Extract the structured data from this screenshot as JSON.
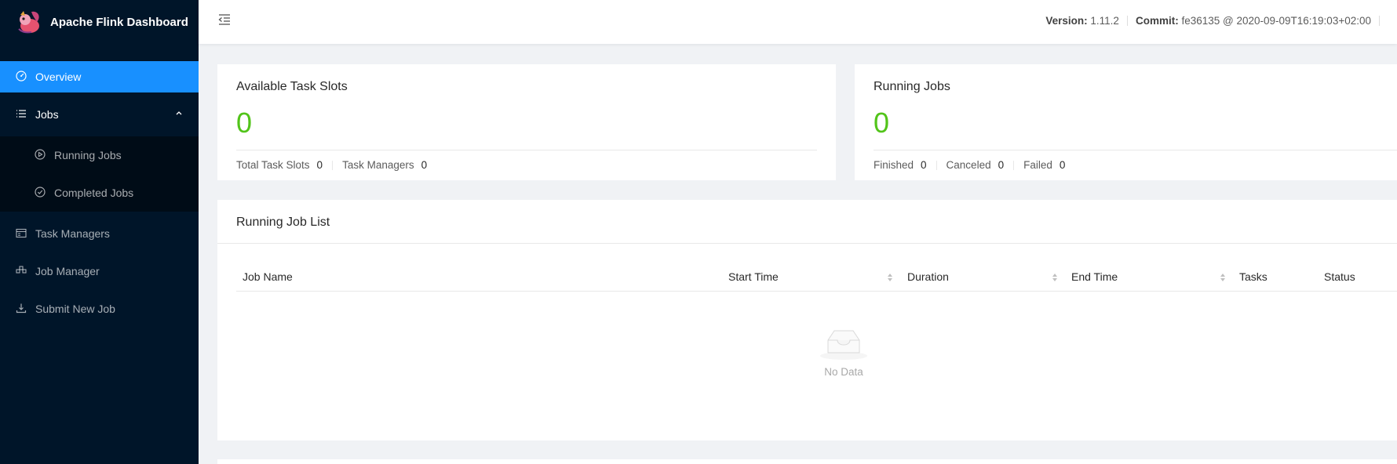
{
  "app": {
    "title": "Apache Flink Dashboard"
  },
  "sidebar": {
    "items": [
      {
        "label": "Overview",
        "icon": "dashboard-icon"
      },
      {
        "label": "Jobs",
        "icon": "list-icon"
      },
      {
        "label": "Running Jobs",
        "icon": "play-circle-icon"
      },
      {
        "label": "Completed Jobs",
        "icon": "check-circle-icon"
      },
      {
        "label": "Task Managers",
        "icon": "schedule-icon"
      },
      {
        "label": "Job Manager",
        "icon": "cluster-icon"
      },
      {
        "label": "Submit New Job",
        "icon": "upload-icon"
      }
    ]
  },
  "header": {
    "version_label": "Version:",
    "version": "1.11.2",
    "commit_label": "Commit:",
    "commit": "fe36135 @ 2020-09-09T16:19:03+02:00"
  },
  "cards": {
    "slots": {
      "title": "Available Task Slots",
      "value": "0",
      "total_label": "Total Task Slots",
      "total_value": "0",
      "tm_label": "Task Managers",
      "tm_value": "0"
    },
    "jobs": {
      "title": "Running Jobs",
      "value": "0",
      "finished_label": "Finished",
      "finished_value": "0",
      "canceled_label": "Canceled",
      "canceled_value": "0",
      "failed_label": "Failed",
      "failed_value": "0"
    }
  },
  "job_list": {
    "title": "Running Job List",
    "columns": [
      "Job Name",
      "Start Time",
      "Duration",
      "End Time",
      "Tasks",
      "Status"
    ],
    "empty_text": "No Data"
  },
  "colors": {
    "accent": "#1890ff",
    "success": "#52c41a",
    "sidebar": "#001529"
  }
}
